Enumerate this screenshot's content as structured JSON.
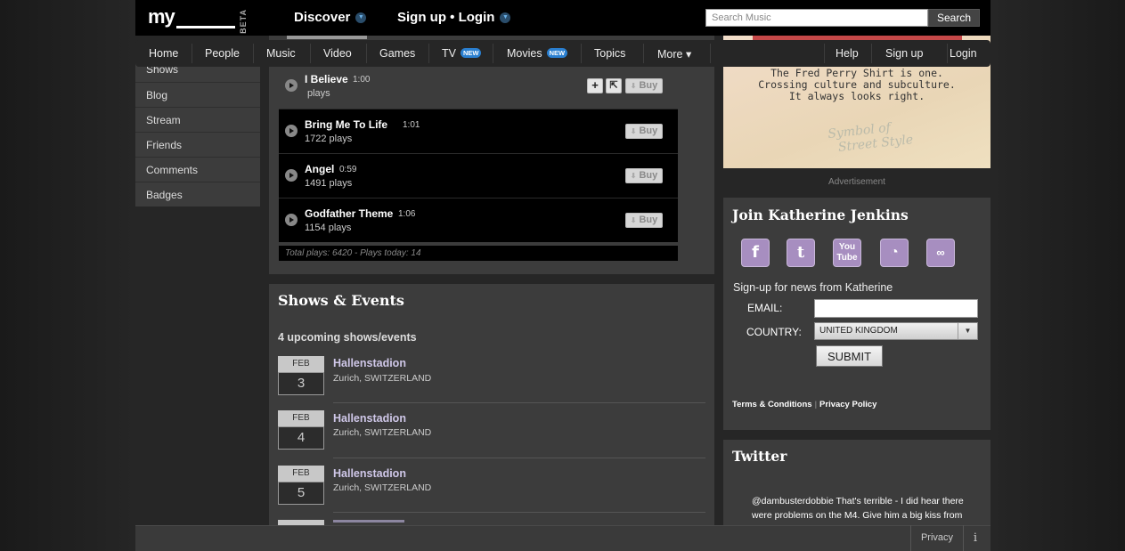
{
  "header": {
    "logo_text": "my",
    "logo_beta": "BETA",
    "discover_label": "Discover",
    "signup_login_label": "Sign up • Login",
    "search_placeholder": "Search Music",
    "search_button": "Search"
  },
  "nav": {
    "items": [
      "Home",
      "People",
      "Music",
      "Video",
      "Games",
      "TV",
      "Movies",
      "Topics",
      "More ▾"
    ],
    "new_badge": "NEW",
    "right_items": [
      "Help",
      "Sign up",
      "Login"
    ]
  },
  "sidebar": {
    "items": [
      "Shows",
      "Blog",
      "Stream",
      "Friends",
      "Comments",
      "Badges"
    ]
  },
  "tracks": [
    {
      "title": "I Believe",
      "duration": "1:00",
      "plays": "plays",
      "buy": "Buy"
    },
    {
      "title": "Bring Me To Life",
      "duration": "1:01",
      "plays": "1722 plays",
      "buy": "Buy"
    },
    {
      "title": "Angel",
      "duration": "0:59",
      "plays": "1491 plays",
      "buy": "Buy"
    },
    {
      "title": "Godfather Theme",
      "duration": "1:06",
      "plays": "1154 plays",
      "buy": "Buy"
    }
  ],
  "tracks_total": "Total plays: 6420 - Plays today: 14",
  "shows": {
    "title": "Shows & Events",
    "count": "4 upcoming shows/events",
    "events": [
      {
        "month": "FEB",
        "day": "3",
        "venue": "Hallenstadion",
        "location": "Zurich, SWITZERLAND"
      },
      {
        "month": "FEB",
        "day": "4",
        "venue": "Hallenstadion",
        "location": "Zurich, SWITZERLAND"
      },
      {
        "month": "FEB",
        "day": "5",
        "venue": "Hallenstadion",
        "location": "Zurich, SWITZERLAND"
      }
    ]
  },
  "ad": {
    "line1": "The Fred Perry Shirt is one.",
    "line2": "Crossing culture and subculture.",
    "line3": "It always looks right.",
    "script1": "Symbol of",
    "script2": "Street Style",
    "label": "Advertisement"
  },
  "join": {
    "title": "Join Katherine Jenkins",
    "social_icons": [
      "facebook-icon",
      "twitter-icon",
      "youtube-icon",
      "rss-icon",
      "lastfm-icon"
    ],
    "youtube_text": "You",
    "youtube_text2": "Tube",
    "signup_heading": "Sign-up for news from Katherine",
    "email_label": "EMAIL:",
    "country_label": "COUNTRY:",
    "country_value": "UNITED KINGDOM",
    "submit": "SUBMIT",
    "terms": "Terms & Conditions",
    "privacy": "Privacy Policy"
  },
  "twitter": {
    "title": "Twitter",
    "tweet": "@dambusterdobbie That's terrible - I did hear there were problems on the M4. Give him a big kiss from"
  },
  "footer": {
    "privacy": "Privacy",
    "info": "i"
  }
}
